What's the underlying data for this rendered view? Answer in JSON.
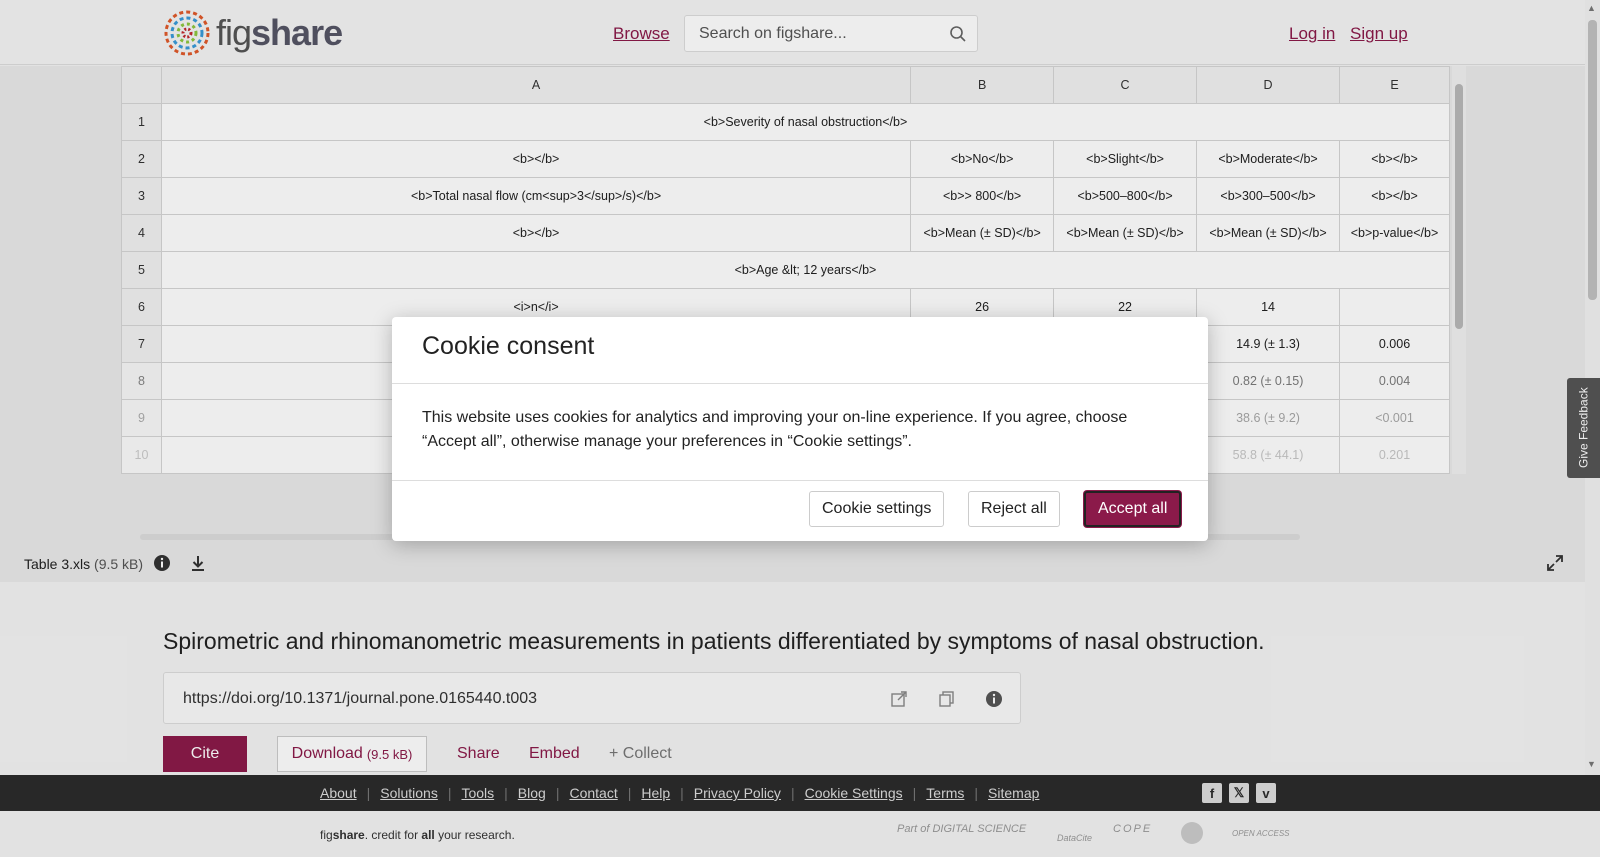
{
  "header": {
    "logo_text_light": "fig",
    "logo_text_bold": "share",
    "browse": "Browse",
    "search_placeholder": "Search on figshare...",
    "login": "Log in",
    "signup": "Sign up"
  },
  "sheet": {
    "columns": [
      "A",
      "B",
      "C",
      "D",
      "E"
    ],
    "rows": [
      {
        "num": "1",
        "cells": [
          "<b>Severity of nasal obstruction</b>"
        ],
        "merged": true
      },
      {
        "num": "2",
        "cells": [
          "<b></b>",
          "<b>No</b>",
          "<b>Slight</b>",
          "<b>Moderate</b>",
          "<b></b>"
        ]
      },
      {
        "num": "3",
        "cells": [
          "<b>Total nasal flow (cm<sup>3</sup>/s)</b>",
          "<b>> 800</b>",
          "<b>500–800</b>",
          "<b>300–500</b>",
          "<b></b>"
        ]
      },
      {
        "num": "4",
        "cells": [
          "<b></b>",
          "<b>Mean (± SD)</b>",
          "<b>Mean (± SD)</b>",
          "<b>Mean (± SD)</b>",
          "<b>p-value</b>"
        ]
      },
      {
        "num": "5",
        "cells": [
          "<b>Age &lt; 12 years</b>"
        ],
        "merged": true
      },
      {
        "num": "6",
        "cells": [
          "<i>n</i>",
          "26",
          "22",
          "14",
          ""
        ]
      },
      {
        "num": "7",
        "cells": [
          "",
          "",
          "",
          "14.9 (± 1.3)",
          "0.006"
        ]
      },
      {
        "num": "8",
        "cells": [
          "",
          "",
          "",
          "0.82 (± 0.15)",
          "0.004"
        ]
      },
      {
        "num": "9",
        "cells": [
          "",
          "",
          "",
          "38.6 (± 9.2)",
          "<0.001"
        ]
      },
      {
        "num": "10",
        "cells": [
          "",
          "",
          "",
          "58.8 (± 44.1)",
          "0.201"
        ]
      }
    ]
  },
  "file": {
    "name": "Table 3.xls",
    "size": "(9.5 kB)"
  },
  "item": {
    "title": "Spirometric and rhinomanometric measurements in patients differentiated by symptoms of nasal obstruction.",
    "doi": "https://doi.org/10.1371/journal.pone.0165440.t003",
    "cite": "Cite",
    "download": "Download",
    "download_size": "(9.5 kB)",
    "share": "Share",
    "embed": "Embed",
    "collect": "+ Collect"
  },
  "feedback": "Give Feedback",
  "footer": {
    "links": [
      "About",
      "Solutions",
      "Tools",
      "Blog",
      "Contact",
      "Help",
      "Privacy Policy",
      "Cookie Settings",
      "Terms",
      "Sitemap"
    ],
    "credit_pre": "fig",
    "credit_bold": "share",
    "credit_mid": ". credit for ",
    "credit_all": "all",
    "credit_post": " your research.",
    "partner_ds": "Part of DIGITAL SCIENCE",
    "partner_datacite": "DataCite",
    "partner_cope": "COPE",
    "partner_oa": "OPEN ACCESS"
  },
  "modal": {
    "title": "Cookie consent",
    "body": "This website uses cookies for analytics and improving your on-line experience. If you agree, choose “Accept all”, otherwise manage your preferences in “Cookie settings”.",
    "settings": "Cookie settings",
    "reject": "Reject all",
    "accept": "Accept all"
  },
  "colors": {
    "brand": "#8b1a4a",
    "footer_bg": "#2c2c2c"
  }
}
